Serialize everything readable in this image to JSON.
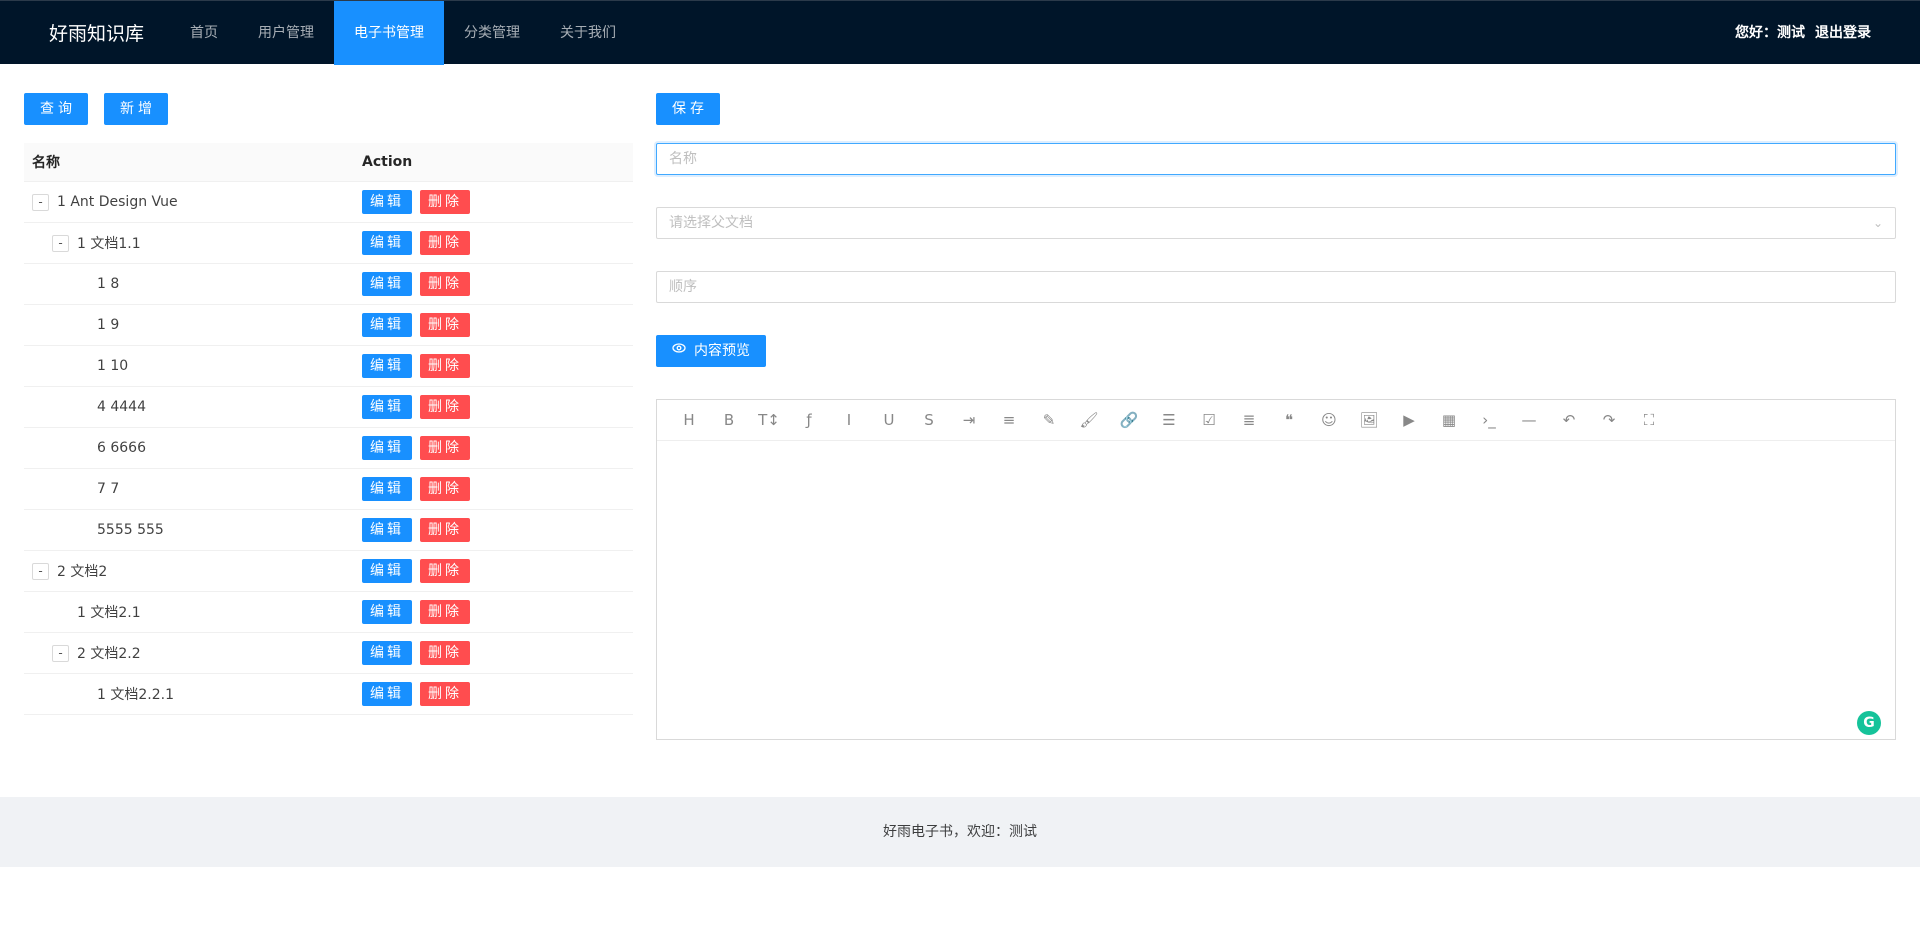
{
  "header": {
    "logo": "好雨知识库",
    "nav": [
      "首页",
      "用户管理",
      "电子书管理",
      "分类管理",
      "关于我们"
    ],
    "active_index": 2,
    "greeting": "您好：测试",
    "logout": "退出登录"
  },
  "toolbar_left": {
    "query_label": "查询",
    "add_label": "新增"
  },
  "table": {
    "col_name": "名称",
    "col_action": "Action",
    "edit_label": "编辑",
    "delete_label": "删除",
    "rows": [
      {
        "name": "1 Ant Design Vue",
        "level": 0,
        "expandable": true
      },
      {
        "name": "1 文档1.1",
        "level": 1,
        "expandable": true
      },
      {
        "name": "1 8",
        "level": 2,
        "expandable": false
      },
      {
        "name": "1 9",
        "level": 2,
        "expandable": false
      },
      {
        "name": "1 10",
        "level": 2,
        "expandable": false
      },
      {
        "name": "4 4444",
        "level": 2,
        "expandable": false
      },
      {
        "name": "6 6666",
        "level": 2,
        "expandable": false
      },
      {
        "name": "7 7",
        "level": 2,
        "expandable": false
      },
      {
        "name": "5555 555",
        "level": 2,
        "expandable": false
      },
      {
        "name": "2 文档2",
        "level": 0,
        "expandable": true
      },
      {
        "name": "1 文档2.1",
        "level": 1,
        "expandable": false
      },
      {
        "name": "2 文档2.2",
        "level": 1,
        "expandable": true
      },
      {
        "name": "1 文档2.2.1",
        "level": 2,
        "expandable": false
      }
    ]
  },
  "form": {
    "save_label": "保存",
    "name_placeholder": "名称",
    "parent_placeholder": "请选择父文档",
    "sort_placeholder": "顺序",
    "preview_label": "内容预览"
  },
  "editor_tools": [
    "H",
    "B",
    "T↕",
    "ƒ",
    "I",
    "U",
    "S",
    "⇥",
    "≡",
    "✎",
    "🖌",
    "🔗",
    "☰",
    "☑",
    "≣",
    "❝",
    "☺",
    "🖼",
    "▶",
    "▦",
    "›_",
    "—",
    "↶",
    "↷",
    "⛶"
  ],
  "footer": {
    "text": "好雨电子书，欢迎：测试"
  },
  "colors": {
    "primary": "#1890ff",
    "danger": "#ff4d4f",
    "header_bg": "#001529"
  }
}
